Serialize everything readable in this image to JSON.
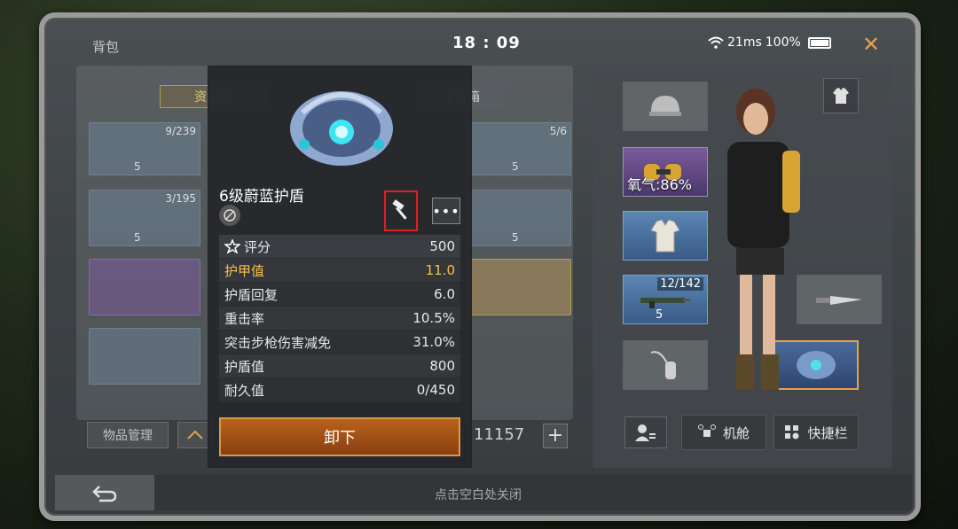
{
  "header": {
    "bag_title": "背包",
    "clock": "18 : 09",
    "ping": "21ms",
    "battery": "100%"
  },
  "inventory": {
    "tab_resources": "资源包",
    "tab_pickup": "拾取箱",
    "slot_counts": [
      "9/239",
      "5/6",
      "3/195"
    ],
    "slot_levels": [
      "5",
      "5",
      "5",
      "5"
    ],
    "manage_button": "物品管理",
    "currency": "11157"
  },
  "popup": {
    "item_name": "6级蔚蓝护盾",
    "stats": [
      {
        "label": "评分",
        "value": "500"
      },
      {
        "label": "护甲值",
        "value": "11.0"
      },
      {
        "label": "护盾回复",
        "value": "6.0"
      },
      {
        "label": "重击率",
        "value": "10.5%"
      },
      {
        "label": "突击步枪伤害减免",
        "value": "31.0%"
      },
      {
        "label": "护盾值",
        "value": "800"
      },
      {
        "label": "耐久值",
        "value": "0/450"
      }
    ],
    "unequip_button": "卸下",
    "more_button": "•••"
  },
  "equipment": {
    "oxygen": "氧气:86%",
    "ammo": "12/142",
    "ammo_level": "5",
    "bay_button": "机舱",
    "quickbar_button": "快捷栏"
  },
  "footer": {
    "close_hint": "点击空白处关闭"
  },
  "colors": {
    "accent_orange": "#d89a4a",
    "highlight_yellow": "#f2c04a",
    "selection_red": "#e02020"
  }
}
